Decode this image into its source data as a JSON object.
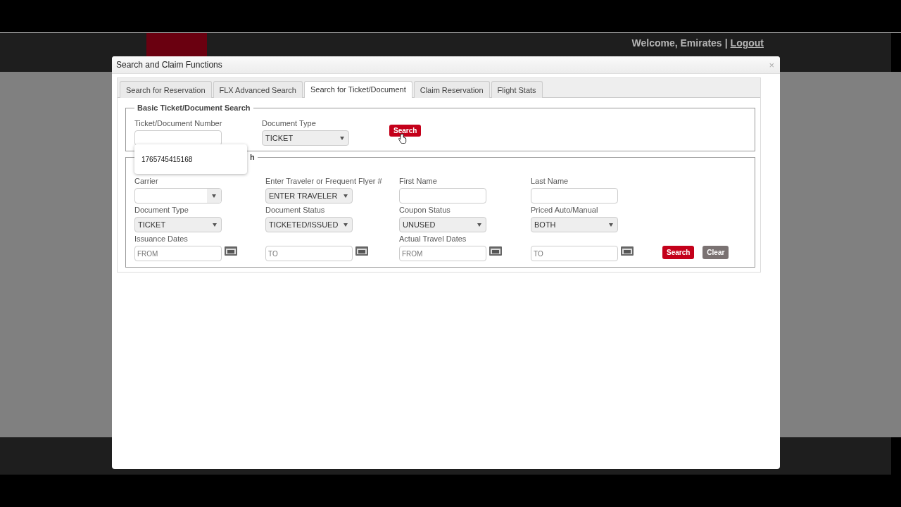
{
  "header": {
    "welcome": "Welcome, Emirates",
    "separator": "|",
    "logout": "Logout"
  },
  "dialog": {
    "title": "Search and Claim Functions",
    "close": "×",
    "tabs": [
      {
        "label": "Search for Reservation",
        "selected": false
      },
      {
        "label": "FLX Advanced Search",
        "selected": false
      },
      {
        "label": "Search for Ticket/Document",
        "selected": true
      },
      {
        "label": "Claim Reservation",
        "selected": false
      },
      {
        "label": "Flight Stats",
        "selected": false
      }
    ],
    "basic_search": {
      "legend": "Basic Ticket/Document Search",
      "fields": [
        {
          "kind": "text",
          "label": "Ticket/Document Number"
        },
        {
          "kind": "select",
          "label": "Document Type",
          "value": "TICKET"
        }
      ],
      "search_button": "Search",
      "autocomplete": [
        "1765745415168"
      ]
    },
    "advanced_search": {
      "legend": "h",
      "fields": [
        {
          "kind": "combo",
          "label": "Carrier"
        },
        {
          "kind": "select",
          "label": "Enter Traveler or Frequent Flyer #",
          "value": "ENTER TRAVELER"
        },
        {
          "kind": "text",
          "label": "First Name"
        },
        {
          "kind": "text",
          "label": "Last Name"
        },
        {
          "kind": "blank"
        },
        {
          "kind": "select",
          "label": "Document Type",
          "value": "TICKET"
        },
        {
          "kind": "select",
          "label": "Document Status",
          "value": "TICKETED/ISSUED"
        },
        {
          "kind": "select",
          "label": "Coupon Status",
          "value": "UNUSED"
        },
        {
          "kind": "select",
          "label": "Priced Auto/Manual",
          "value": "BOTH"
        },
        {
          "kind": "blank"
        },
        {
          "kind": "date",
          "label": "Issuance Dates",
          "placeholder": "FROM"
        },
        {
          "kind": "date",
          "placeholder": "TO"
        },
        {
          "kind": "date",
          "label": "Actual Travel Dates",
          "placeholder": "FROM"
        },
        {
          "kind": "date",
          "placeholder": "TO"
        },
        {
          "kind": "buttons"
        }
      ],
      "buttons": [
        {
          "kind": "primary",
          "label": "Search"
        },
        {
          "kind": "secondary",
          "label": "Clear"
        }
      ]
    }
  }
}
